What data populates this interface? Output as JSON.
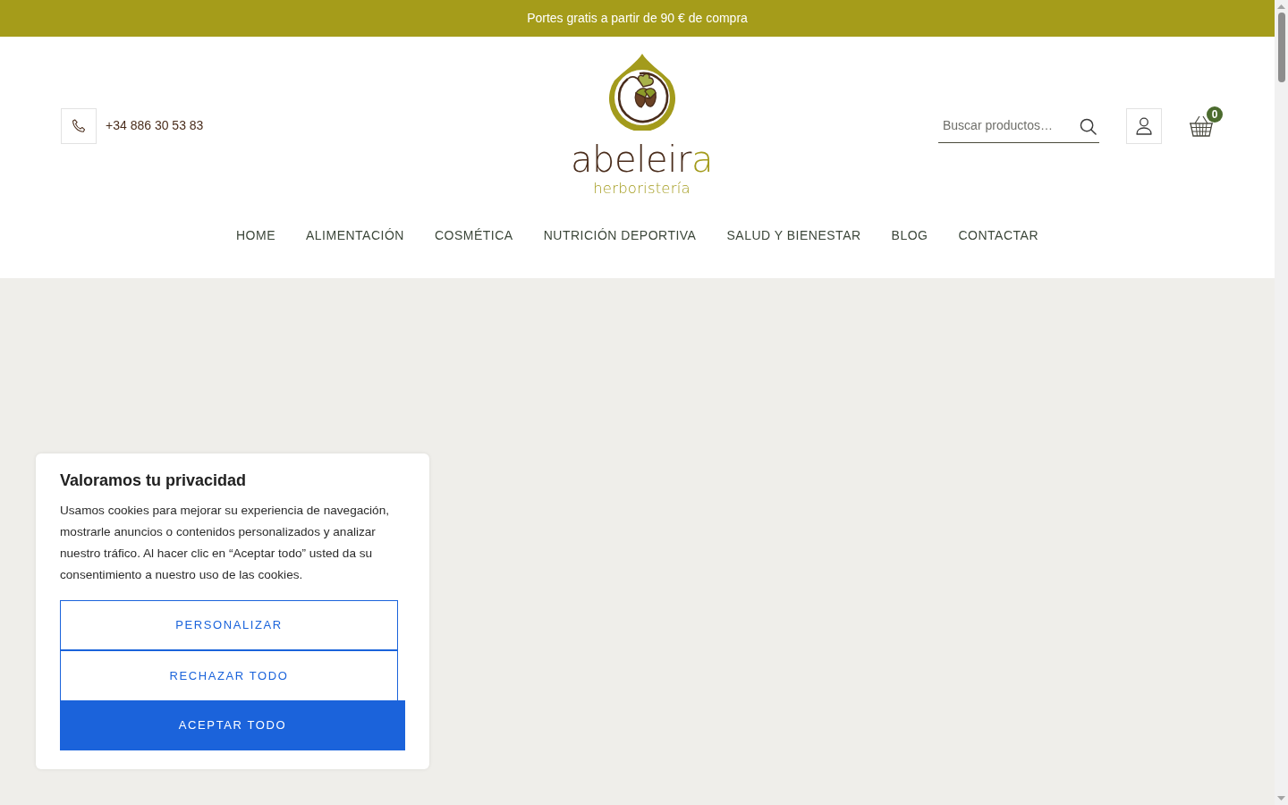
{
  "promo_bar": {
    "text": "Portes gratis a partir de 90 € de compra"
  },
  "header": {
    "phone": "+34 886 30 53 83",
    "logo": {
      "wordmark": {
        "main": "abeleir",
        "accent": "a"
      },
      "tagline": "herboristería"
    },
    "search": {
      "placeholder": "Buscar productos…"
    },
    "cart": {
      "count": "0"
    }
  },
  "nav": {
    "items": [
      {
        "label": "HOME"
      },
      {
        "label": "ALIMENTACIÓN"
      },
      {
        "label": "COSMÉTICA"
      },
      {
        "label": "NUTRICIÓN DEPORTIVA"
      },
      {
        "label": "SALUD Y BIENESTAR"
      },
      {
        "label": "BLOG"
      },
      {
        "label": "CONTACTAR"
      }
    ]
  },
  "cookie_banner": {
    "title": "Valoramos tu privacidad",
    "text": "Usamos cookies para mejorar su experiencia de navegación, mostrarle anuncios o contenidos personalizados y analizar nuestro tráfico. Al hacer clic en “Aceptar todo” usted da su consentimiento a nuestro uso de las cookies.",
    "buttons": [
      {
        "label": "PERSONALIZAR",
        "kind": "outline"
      },
      {
        "label": "RECHAZAR TODO",
        "kind": "outline"
      },
      {
        "label": "ACEPTAR TODO",
        "kind": "primary"
      }
    ]
  }
}
